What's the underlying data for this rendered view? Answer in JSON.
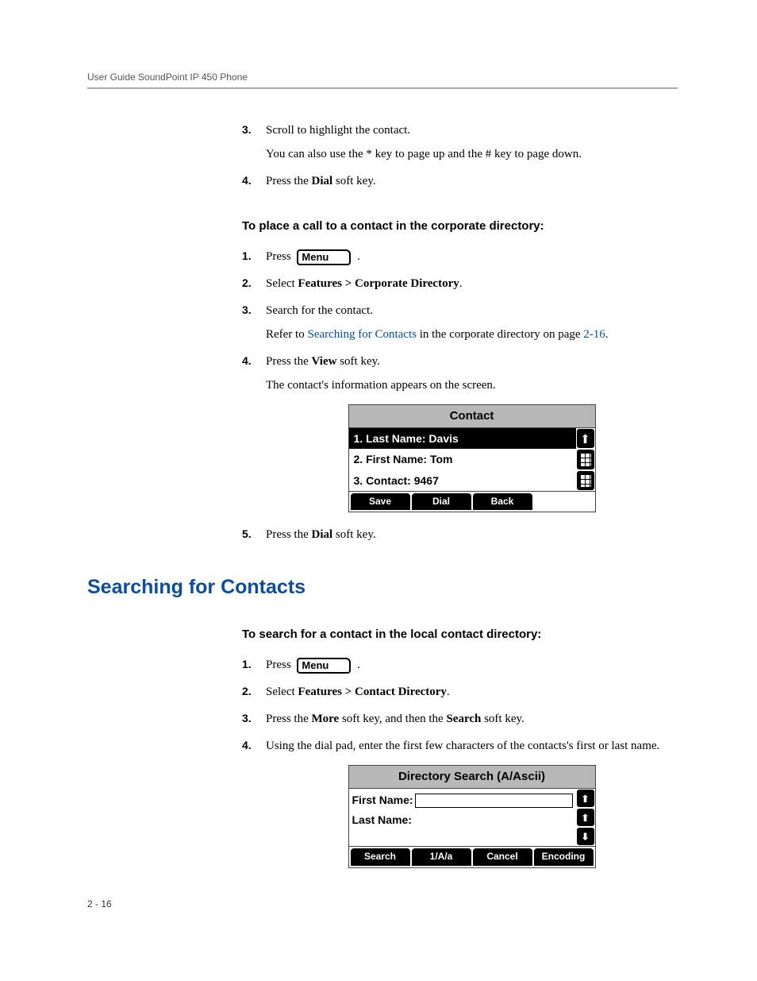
{
  "header": "User Guide SoundPoint IP 450 Phone",
  "footer": "2 - 16",
  "stepsA_start": 3,
  "stepsA": [
    {
      "n": "3.",
      "text": "Scroll to highlight the contact.",
      "sub": "You can also use the * key to page up and the # key to page down."
    },
    {
      "n": "4.",
      "prefix": "Press the ",
      "bold": "Dial",
      "suffix": " soft key."
    }
  ],
  "taskB_heading": "To place a call to a contact in the corporate directory:",
  "stepsB": [
    {
      "n": "1.",
      "pressText": "Press ",
      "menuLabel": "Menu",
      "after": " ."
    },
    {
      "n": "2.",
      "prefix": "Select ",
      "bold": "Features > Corporate Directory",
      "suffix": "."
    },
    {
      "n": "3.",
      "text": "Search for the contact.",
      "sub_prefix": "Refer to ",
      "sub_link": "Searching for Contacts",
      "sub_mid": " in the corporate directory on page ",
      "sub_link2": "2-16",
      "sub_suffix": "."
    },
    {
      "n": "4.",
      "prefix": "Press the ",
      "bold": "View",
      "suffix": " soft key.",
      "sub": "The contact's information appears on the screen."
    },
    {
      "n": "5.",
      "prefix": "Press the ",
      "bold": "Dial",
      "suffix": " soft key."
    }
  ],
  "lcd1": {
    "title": "Contact",
    "rows": [
      {
        "text": "1. Last Name: Davis",
        "selected": true
      },
      {
        "text": "2. First Name: Tom",
        "selected": false
      },
      {
        "text": "3. Contact: 9467",
        "selected": false
      }
    ],
    "softkeys": [
      "Save",
      "Dial",
      "Back"
    ]
  },
  "section_title": "Searching for Contacts",
  "taskC_heading": "To search for a contact in the local contact directory:",
  "stepsC": [
    {
      "n": "1.",
      "pressText": "Press ",
      "menuLabel": "Menu",
      "after": " ."
    },
    {
      "n": "2.",
      "prefix": "Select ",
      "bold": "Features > Contact Directory",
      "suffix": "."
    },
    {
      "n": "3.",
      "prefix": "Press the ",
      "bold": "More",
      "mid": " soft key, and then the ",
      "bold2": "Search",
      "suffix": " soft key."
    },
    {
      "n": "4.",
      "text": "Using the dial pad, enter the first few characters of the contacts's first or last name."
    }
  ],
  "lcd2": {
    "title": "Directory Search (A/Ascii)",
    "fields": [
      {
        "label": "First Name:"
      },
      {
        "label": "Last Name:"
      }
    ],
    "softkeys": [
      "Search",
      "1/A/a",
      "Cancel",
      "Encoding"
    ]
  }
}
